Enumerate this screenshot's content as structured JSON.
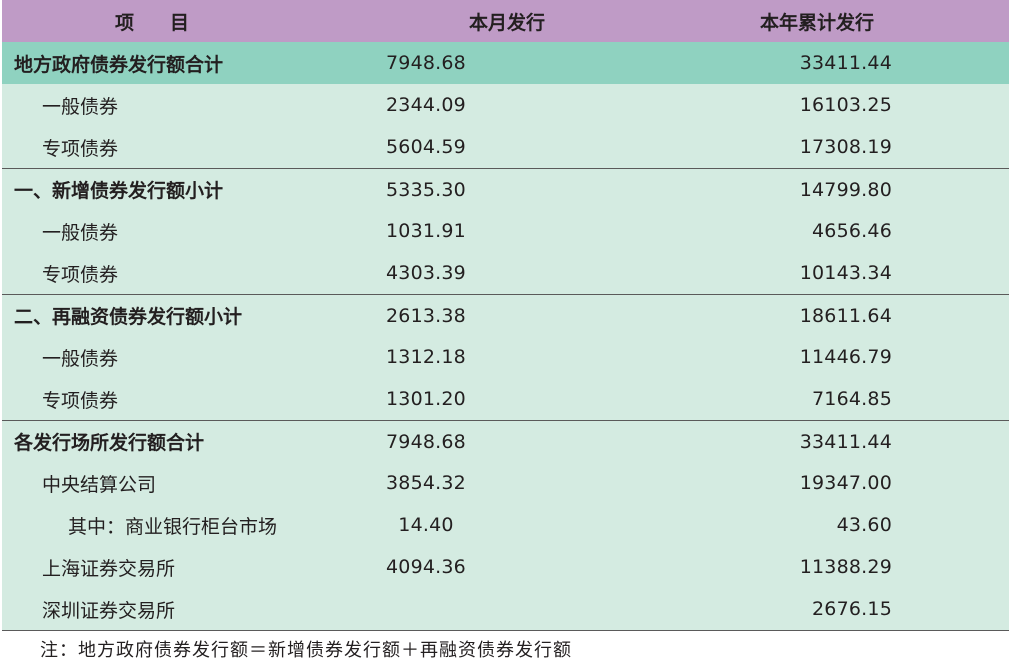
{
  "header": {
    "col_item_a": "项",
    "col_item_b": "目",
    "col_month": "本月发行",
    "col_year": "本年累计发行"
  },
  "rows": [
    {
      "label": "地方政府债券发行额合计",
      "month": "7948.68",
      "year": "33411.44"
    },
    {
      "label": "一般债券",
      "month": "2344.09",
      "year": "16103.25"
    },
    {
      "label": "专项债券",
      "month": "5604.59",
      "year": "17308.19"
    },
    {
      "label": "一、新增债券发行额小计",
      "month": "5335.30",
      "year": "14799.80"
    },
    {
      "label": "一般债券",
      "month": "1031.91",
      "year": "4656.46"
    },
    {
      "label": "专项债券",
      "month": "4303.39",
      "year": "10143.34"
    },
    {
      "label": "二、再融资债券发行额小计",
      "month": "2613.38",
      "year": "18611.64"
    },
    {
      "label": "一般债券",
      "month": "1312.18",
      "year": "11446.79"
    },
    {
      "label": "专项债券",
      "month": "1301.20",
      "year": "7164.85"
    },
    {
      "label": "各发行场所发行额合计",
      "month": "7948.68",
      "year": "33411.44"
    },
    {
      "label": "中央结算公司",
      "month": "3854.32",
      "year": "19347.00"
    },
    {
      "label": "其中：商业银行柜台市场",
      "month": "14.40",
      "year": "43.60"
    },
    {
      "label": "上海证券交易所",
      "month": "4094.36",
      "year": "11388.29"
    },
    {
      "label": "深圳证券交易所",
      "month": "",
      "year": "2676.15"
    }
  ],
  "note": "注：地方政府债券发行额＝新增债券发行额＋再融资债券发行额"
}
